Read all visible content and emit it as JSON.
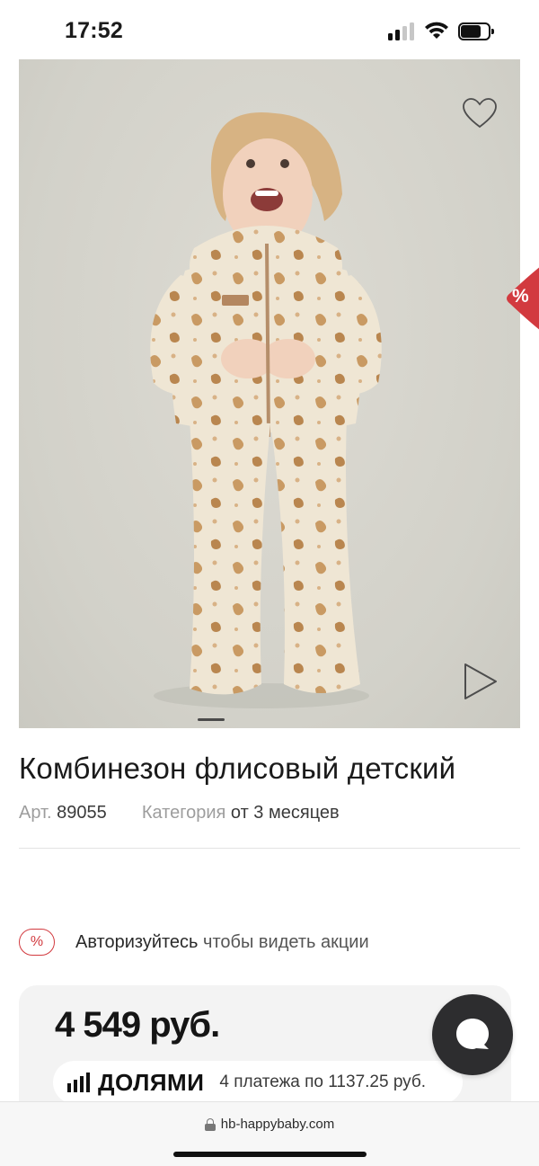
{
  "status_bar": {
    "time": "17:52",
    "icons": [
      "cellular-signal-icon",
      "wifi-icon",
      "battery-icon"
    ]
  },
  "product": {
    "image_alt": "child-fleece-jumpsuit-photo",
    "title": "Комбинезон флисовый детский",
    "article_label": "Арт.",
    "article_value": "89055",
    "category_label": "Категория",
    "category_value": "от 3 месяцев",
    "favorite_icon": "heart-icon",
    "video_icon": "play-icon",
    "carousel_active_slide": 1
  },
  "discount_tab": {
    "label": "%",
    "color": "#d23a3f"
  },
  "promo": {
    "badge": "%",
    "link_text": "Авторизуйтесь",
    "rest_text": "чтобы видеть акции"
  },
  "pricing": {
    "price": "4 549 руб.",
    "installment_brand": "ДОЛЯМИ",
    "installment_text": "4 платежа по 1137.25 руб."
  },
  "chat": {
    "icon": "chat-bubble-icon"
  },
  "browser": {
    "url": "hb-happybaby.com",
    "lock_icon": "lock-icon"
  },
  "colors": {
    "accent_red": "#d23a3f",
    "chat_button": "#2d2d2f",
    "price_card_bg": "#f3f3f3"
  }
}
